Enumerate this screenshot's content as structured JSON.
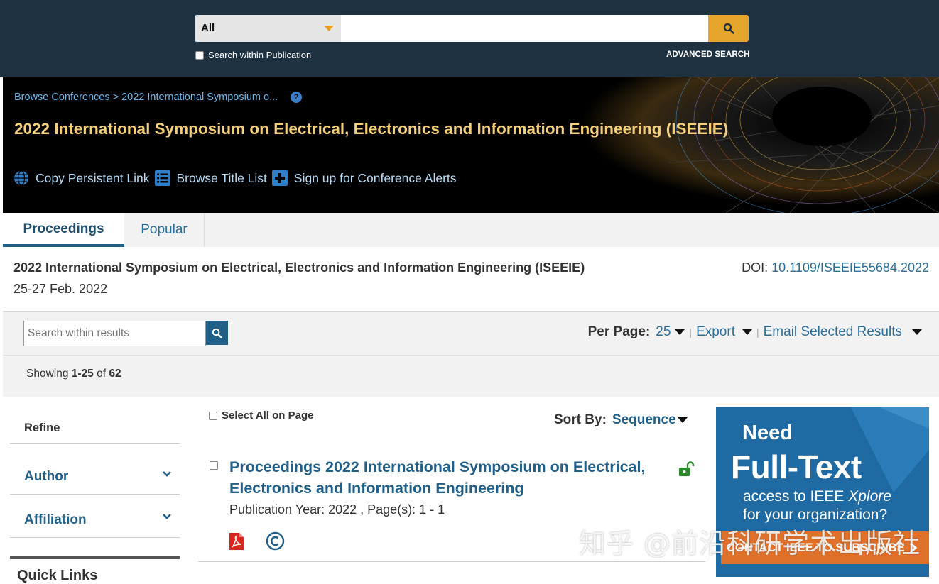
{
  "search": {
    "scope_value": "All",
    "query_value": "",
    "within_publication_label": "Search within Publication",
    "advanced_search_label": "ADVANCED SEARCH"
  },
  "banner": {
    "breadcrumb": "Browse Conferences > 2022 International Symposium o...",
    "title": "2022 International Symposium on Electrical, Electronics and Information Engineering (ISEEIE)",
    "actions": [
      {
        "label": "Copy Persistent Link",
        "icon": "globe-icon"
      },
      {
        "label": "Browse Title List",
        "icon": "list-icon"
      },
      {
        "label": "Sign up for Conference Alerts",
        "icon": "plus-icon"
      }
    ]
  },
  "tabs": [
    {
      "label": "Proceedings",
      "active": true
    },
    {
      "label": "Popular",
      "active": false
    }
  ],
  "info": {
    "title": "2022 International Symposium on Electrical, Electronics and Information Engineering (ISEEIE)",
    "date": "25-27 Feb. 2022",
    "doi_label": "DOI:",
    "doi_value": "10.1109/ISEEIE55684.2022"
  },
  "toolbar": {
    "within_results_placeholder": "Search within results",
    "per_page_label": "Per Page:",
    "per_page_value": "25",
    "export_label": "Export",
    "email_label": "Email Selected Results",
    "separator": "|"
  },
  "showing": {
    "prefix": "Showing",
    "range": "1-25",
    "of": "of",
    "total": "62"
  },
  "refine": {
    "title": "Refine",
    "items": [
      {
        "label": "Author"
      },
      {
        "label": "Affiliation"
      }
    ],
    "quick_links_title": "Quick Links"
  },
  "results": {
    "select_all_label": "Select All on Page",
    "sort_by_label": "Sort By:",
    "sort_by_value": "Sequence",
    "items": [
      {
        "title": "Proceedings 2022 International Symposium on Electrical, Electronics and Information Engineering",
        "meta": "Publication Year: 2022 , Page(s): 1  -  1"
      }
    ]
  },
  "ad": {
    "line1": "Need",
    "line2": "Full-Text",
    "line3": "access to IEEE ",
    "line3_italic": "Xplore",
    "line4": "for your organization?",
    "cta": "CONTACT IEEE TO SUBSCRIBE"
  },
  "watermark": "知乎 @前沿科研学术出版社",
  "colors": {
    "topbar": "#1e3141",
    "accent_gold": "#e5a52a",
    "banner_title": "#f3cf7c",
    "link_blue": "#2a6e9a",
    "ad_blue": "#1f6aa2",
    "ad_orange": "#e0712a"
  }
}
